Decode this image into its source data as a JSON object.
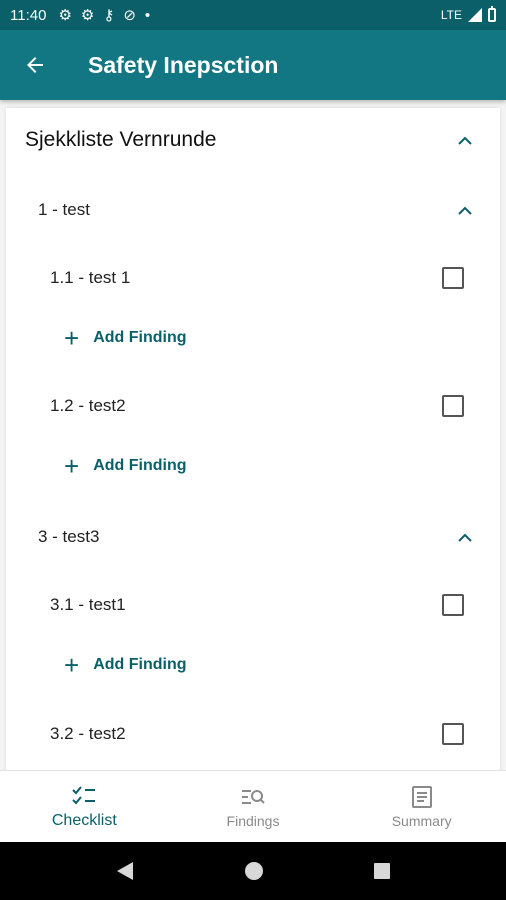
{
  "status_bar": {
    "time": "11:40",
    "network": "LTE"
  },
  "app_bar": {
    "title": "Safety Inepsction"
  },
  "checklist": {
    "title": "Sjekkliste Vernrunde",
    "sections": [
      {
        "label": "1 - test",
        "items": [
          {
            "label": "1.1 - test 1",
            "add": "Add Finding"
          },
          {
            "label": "1.2 - test2",
            "add": "Add Finding"
          }
        ]
      },
      {
        "label": "3 - test3",
        "items": [
          {
            "label": "3.1 - test1",
            "add": "Add Finding"
          },
          {
            "label": "3.2 - test2"
          }
        ]
      }
    ]
  },
  "bottom_nav": {
    "checklist": "Checklist",
    "findings": "Findings",
    "summary": "Summary"
  },
  "colors": {
    "primary": "#127782",
    "primary_dark": "#0b5f69",
    "text": "#222222",
    "inactive": "#8a8a8a"
  }
}
